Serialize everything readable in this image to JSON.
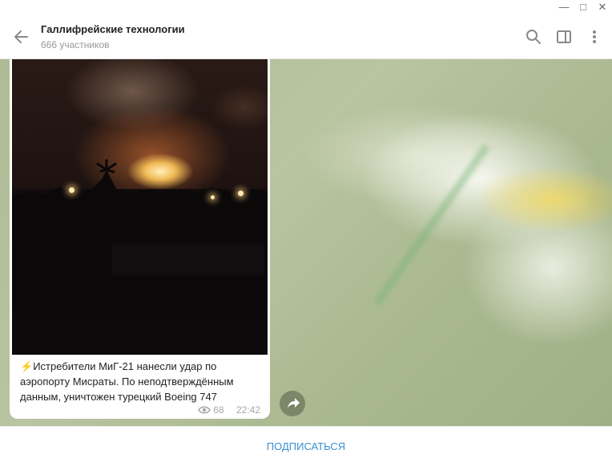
{
  "window": {
    "minimize_glyph": "—",
    "maximize_glyph": "□",
    "close_glyph": "✕"
  },
  "header": {
    "title": "Галлифрейские технологии",
    "subtitle": "666 участников",
    "icons": [
      "back-arrow-icon",
      "search-icon",
      "sidebar-toggle-icon",
      "more-vert-icon"
    ]
  },
  "message": {
    "emoji": "⚡",
    "text": "Истребители МиГ-21 нанесли удар по аэропорту Мисраты. По неподтверждённым данным, уничтожен турецкий Boeing 747",
    "views": "68",
    "time": "22:42"
  },
  "footer": {
    "subscribe_label": "ПОДПИСАТЬСЯ"
  },
  "colors": {
    "accent": "#3a8fd0",
    "meta_text": "#a7a7a7"
  }
}
